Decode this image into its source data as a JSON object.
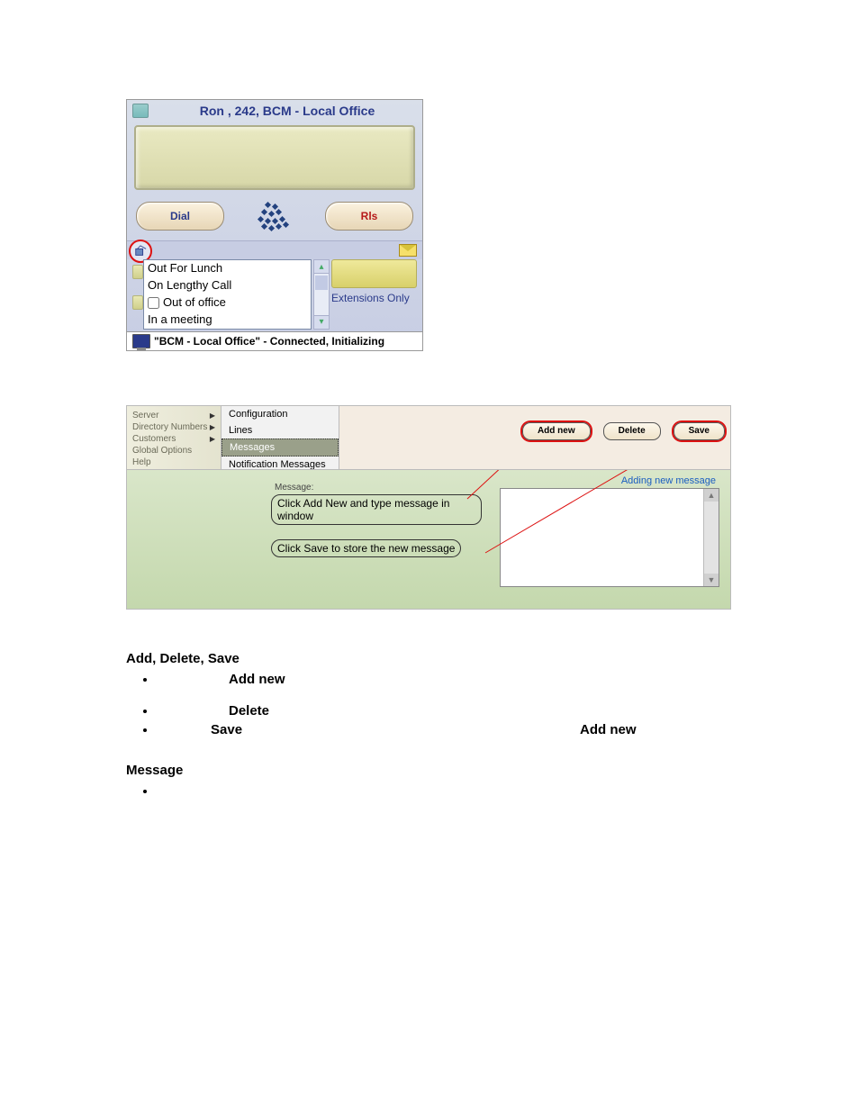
{
  "fig1": {
    "title": "Ron , 242, BCM - Local Office",
    "dial_label": "Dial",
    "rls_label": "Rls",
    "status_items": [
      "Out For Lunch",
      "On Lengthy Call",
      "Out of office",
      "In a meeting"
    ],
    "extensions_only": "Extensions Only",
    "statusbar": "\"BCM - Local Office\" - Connected, Initializing"
  },
  "fig2": {
    "left_menu": [
      "Server",
      "Directory Numbers",
      "Customers",
      "Global Options",
      "Help"
    ],
    "sub_menu": [
      "Configuration",
      "Lines",
      "Messages",
      "Notification Messages"
    ],
    "sub_selected_index": 2,
    "toolbar": {
      "add": "Add new",
      "delete": "Delete",
      "save": "Save"
    },
    "panel": {
      "message_label": "Message:",
      "callout1": "Click Add New and type message in window",
      "callout2": "Click Save to store the new message",
      "adding_text": "Adding new message"
    }
  },
  "doc": {
    "heading1": "Add, Delete, Save",
    "bullets1": [
      {
        "bold": "Add new"
      },
      {
        "bold": "Delete"
      },
      {
        "bold": "Save",
        "right": "Add new"
      }
    ],
    "heading2": "Message"
  }
}
